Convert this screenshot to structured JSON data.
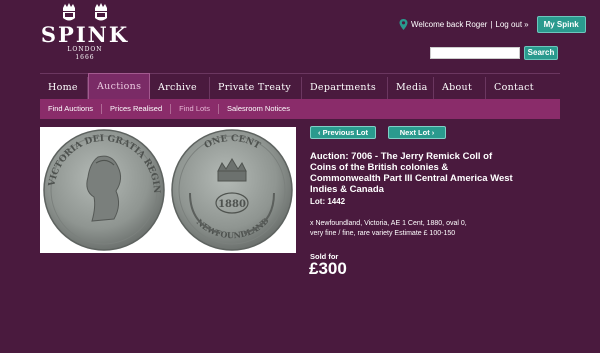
{
  "header": {
    "brand": "SPINK",
    "brand_sub_1": "LONDON",
    "brand_sub_2": "1666",
    "welcome_text": "Welcome back Roger",
    "logout_label": "Log out",
    "separator": "|",
    "arrow": "»",
    "my_spink_label": "My Spink",
    "search_value": "",
    "search_button": "Search"
  },
  "nav": {
    "items": [
      {
        "label": "Home"
      },
      {
        "label": "Auctions"
      },
      {
        "label": "Archive"
      },
      {
        "label": "Private Treaty"
      },
      {
        "label": "Departments"
      },
      {
        "label": "Media"
      },
      {
        "label": "About"
      },
      {
        "label": "Contact"
      }
    ],
    "active": "Auctions"
  },
  "subnav": {
    "items": [
      {
        "label": "Find Auctions"
      },
      {
        "label": "Prices Realised"
      },
      {
        "label": "Find Lots"
      },
      {
        "label": "Salesroom Notices"
      }
    ],
    "active": "Find Lots"
  },
  "lot": {
    "prev_label": "Previous Lot",
    "next_label": "Next Lot",
    "title": "Auction: 7006 - The Jerry Remick Coll of Coins of the British colonies & Commonwealth Part III Central America West Indies & Canada",
    "lot_number": "Lot: 1442",
    "description": "x Newfoundland, Victoria, AE 1 Cent, 1880, oval 0, very fine / fine, rare variety Estimate £ 100-150",
    "sold_label": "Sold for",
    "price": "£300",
    "coin_obverse_legend": "VICTORIA DEI GRATIA REGINA",
    "coin_reverse_legend": "ONE CENT",
    "coin_reverse_bottom": "NEWFOUNDLAND",
    "coin_year": "1880"
  },
  "colors": {
    "background": "#4a1a3e",
    "subnav": "#8a2c6a",
    "accent": "#2a9a8e",
    "coin": "#8f9591"
  },
  "icons": [
    "crest-icon",
    "crest-icon",
    "location-pin-icon",
    "chevron-left-icon",
    "chevron-right-icon"
  ]
}
